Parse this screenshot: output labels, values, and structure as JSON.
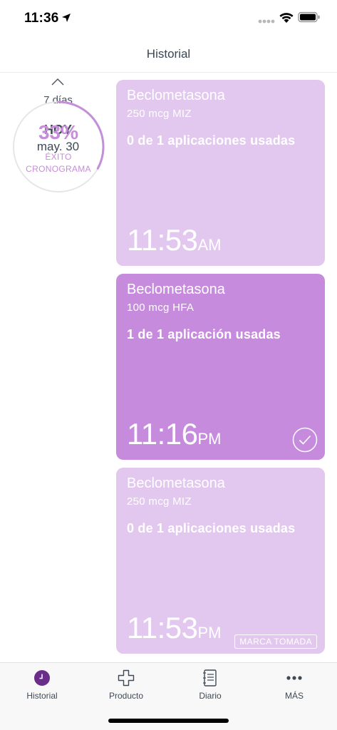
{
  "status_bar": {
    "time": "11:36"
  },
  "header": {
    "title": "Historial"
  },
  "summary": {
    "range": "7 días",
    "today": "HOY",
    "date": "may. 30",
    "percent": "33%",
    "percent_value": 0.33,
    "caption_line1": "ÉXITO",
    "caption_line2": "CRONOGRAMA",
    "accent_color": "#c58ed8"
  },
  "cards": [
    {
      "name": "Beclometasona",
      "dose": "250 mcg MIZ",
      "usage": "0 de 1 aplicaciones usadas",
      "time": "11:53",
      "ampm": "AM",
      "status": "pending"
    },
    {
      "name": "Beclometasona",
      "dose": "100 mcg HFA",
      "usage": "1 de 1 aplicación usadas",
      "time": "11:16",
      "ampm": "PM",
      "status": "taken"
    },
    {
      "name": "Beclometasona",
      "dose": "250 mcg MIZ",
      "usage": "0 de 1 aplicaciones usadas",
      "time": "11:53",
      "ampm": "PM",
      "status": "pending",
      "action": "MARCA TOMADA"
    }
  ],
  "tabs": [
    {
      "label": "Historial",
      "icon": "clock-icon",
      "active": true
    },
    {
      "label": "Producto",
      "icon": "medical-cross-icon",
      "active": false
    },
    {
      "label": "Diario",
      "icon": "notebook-icon",
      "active": false
    },
    {
      "label": "MÁS",
      "icon": "more-dots-icon",
      "active": false
    }
  ],
  "colors": {
    "card_pending": "#e2c8ee",
    "card_taken": "#c68bdd",
    "tab_active": "#6b2d8a"
  }
}
